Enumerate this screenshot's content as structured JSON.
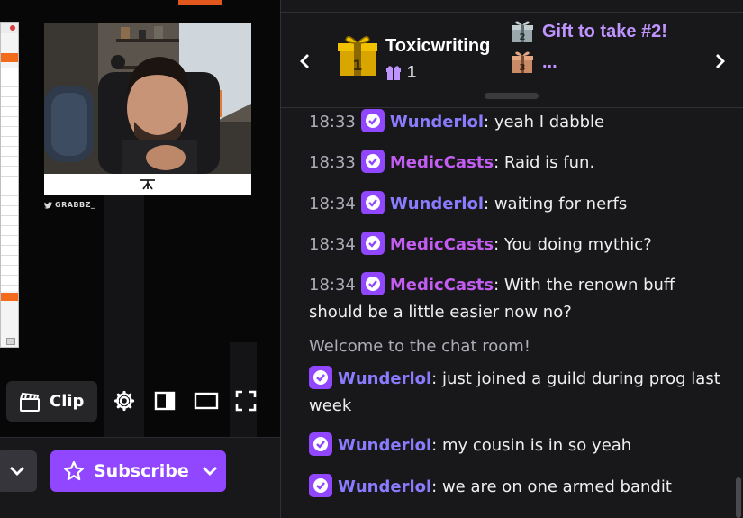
{
  "video": {
    "cam_handle": "GRABBZ_",
    "clip_label": "Clip"
  },
  "action_bar": {
    "subscribe_label": "Subscribe"
  },
  "gift_leaderboard": {
    "top": {
      "rank": "1",
      "name": "Toxicwriting",
      "count": "1"
    },
    "second": {
      "rank": "2",
      "label": "Gift to take #2!"
    },
    "third": {
      "rank": "3",
      "label": "..."
    }
  },
  "chat": {
    "messages": [
      {
        "time": "18:33",
        "user": "Wunderlol",
        "text": ": yeah I dabble"
      },
      {
        "time": "18:33",
        "user": "MedicCasts",
        "text": ": Raid is fun."
      },
      {
        "time": "18:34",
        "user": "Wunderlol",
        "text": ": waiting for nerfs"
      },
      {
        "time": "18:34",
        "user": "MedicCasts",
        "text": ": You doing mythic?"
      },
      {
        "time": "18:34",
        "user": "MedicCasts",
        "text": ": With the renown buff should be a little easier now no?"
      },
      {
        "user": "Wunderlol",
        "text": ": just joined a guild during prog last week"
      },
      {
        "user": "Wunderlol",
        "text": ": my cousin is in so yeah"
      },
      {
        "user": "Wunderlol",
        "text": ": we are on one armed bandit"
      }
    ],
    "system_message": "Welcome to the chat room!"
  },
  "colors": {
    "accent_purple": "#9147ff",
    "username_wunderlol": "#8a7bff",
    "username_mediccasts": "#c35df2",
    "gift_text": "#bf94ff",
    "timestamp": "#adadb8"
  },
  "icons": [
    "clip-icon",
    "settings-gear-icon",
    "theatre-mode-icon",
    "player-size-icon",
    "fullscreen-icon",
    "chevron-down-icon",
    "star-icon",
    "gift-icon",
    "verified-badge-icon",
    "chevron-left-icon",
    "chevron-right-icon",
    "twitter-icon"
  ]
}
